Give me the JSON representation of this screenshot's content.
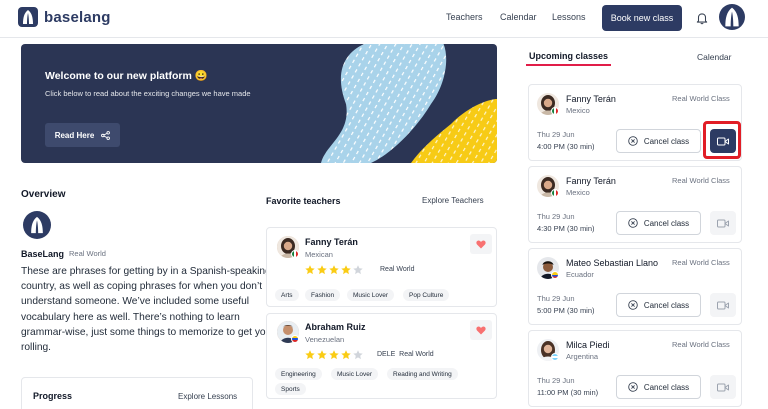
{
  "header": {
    "brand": "baselang",
    "nav": [
      "Teachers",
      "Calendar",
      "Lessons"
    ],
    "book_button": "Book new class"
  },
  "banner": {
    "title": "Welcome to our new platform 😀",
    "text": "Click below to read about the exciting changes we have made",
    "button": "Read Here"
  },
  "overview": {
    "title": "Overview",
    "name": "BaseLang",
    "subtitle": "Real World",
    "description": "These are phrases for getting by in a Spanish-speaking country, as well as coping phrases for when you don’t understand someone. We’ve included some useful vocabulary here as well. There’s nothing to learn grammar-wise, just some things to memorize to get you rolling."
  },
  "progress": {
    "title": "Progress",
    "link": "Explore Lessons"
  },
  "favorites": {
    "title": "Favorite teachers",
    "link": "Explore Teachers",
    "teachers": [
      {
        "name": "Fanny Terán",
        "country": "Mexican",
        "rating": 4,
        "badges": "Real World",
        "tags": [
          "Arts",
          "Fashion",
          "Music Lover",
          "Pop Culture"
        ]
      },
      {
        "name": "Abraham Ruiz",
        "country": "Venezuelan",
        "rating": 4,
        "badges": "DELE  Real World",
        "tags": [
          "Engineering",
          "Music Lover",
          "Reading and Writing",
          "Sports"
        ]
      }
    ]
  },
  "upcoming": {
    "tab_active": "Upcoming classes",
    "tab_other": "Calendar",
    "cancel_label": "Cancel class",
    "classes": [
      {
        "name": "Fanny Terán",
        "country": "Mexico",
        "type": "Real World Class",
        "date": "Thu 29 Jun",
        "time": "4:00 PM (30 min)"
      },
      {
        "name": "Fanny Terán",
        "country": "Mexico",
        "type": "Real World Class",
        "date": "Thu 29 Jun",
        "time": "4:30 PM (30 min)"
      },
      {
        "name": "Mateo Sebastian Llano",
        "country": "Ecuador",
        "type": "Real World Class",
        "date": "Thu 29 Jun",
        "time": "5:00 PM (30 min)"
      },
      {
        "name": "Milca Piedi",
        "country": "Argentina",
        "type": "Real World Class",
        "date": "Thu 29 Jun",
        "time": "11:00 PM (30 min)"
      }
    ]
  },
  "colors": {
    "brand": "#2d3b63",
    "highlight": "#e11d26",
    "star": "#facc15",
    "heart": "#f87171"
  }
}
